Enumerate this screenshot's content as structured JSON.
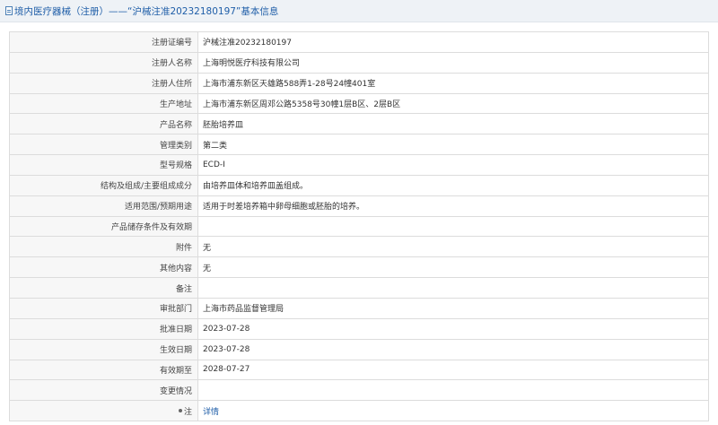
{
  "header": {
    "title": "境内医疗器械（注册）——“沪械注准20232180197”基本信息",
    "icon": "document-icon"
  },
  "rows": [
    {
      "label": "注册证编号",
      "value": "沪械注准20232180197"
    },
    {
      "label": "注册人名称",
      "value": "上海明悦医疗科技有限公司"
    },
    {
      "label": "注册人住所",
      "value": "上海市浦东新区天雄路588弄1-28号24幢401室"
    },
    {
      "label": "生产地址",
      "value": "上海市浦东新区周邓公路5358号30幢1层B区、2层B区"
    },
    {
      "label": "产品名称",
      "value": "胚胎培养皿"
    },
    {
      "label": "管理类别",
      "value": "第二类"
    },
    {
      "label": "型号规格",
      "value": "ECD-I"
    },
    {
      "label": "结构及组成/主要组成成分",
      "value": "由培养皿体和培养皿盖组成。"
    },
    {
      "label": "适用范围/预期用途",
      "value": "适用于时差培养箱中卵母细胞或胚胎的培养。"
    },
    {
      "label": "产品储存条件及有效期",
      "value": ""
    },
    {
      "label": "附件",
      "value": "无"
    },
    {
      "label": "其他内容",
      "value": "无"
    },
    {
      "label": "备注",
      "value": ""
    },
    {
      "label": "审批部门",
      "value": "上海市药品监督管理局"
    },
    {
      "label": "批准日期",
      "value": "2023-07-28"
    },
    {
      "label": "生效日期",
      "value": "2023-07-28"
    },
    {
      "label": "有效期至",
      "value": "2028-07-27"
    },
    {
      "label": "变更情况",
      "value": ""
    }
  ],
  "note_row": {
    "label": "注",
    "link_label": "详情"
  }
}
